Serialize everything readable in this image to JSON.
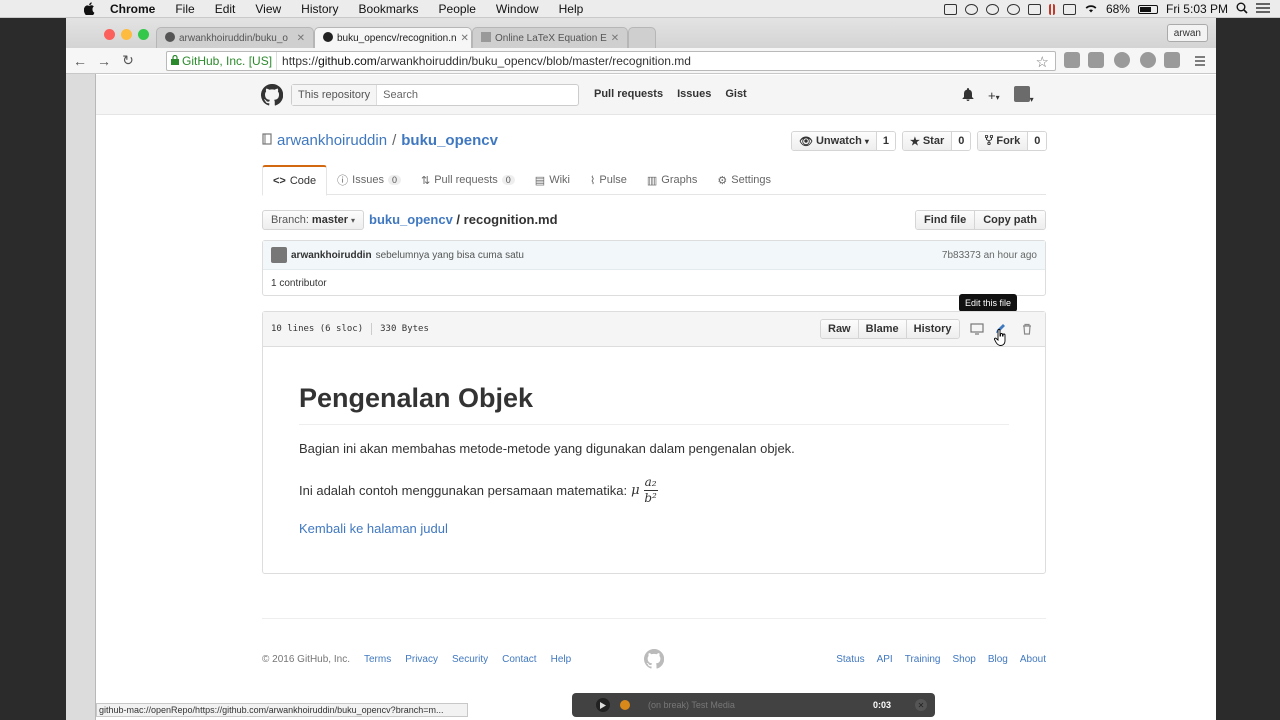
{
  "macos": {
    "app_name": "Chrome",
    "menus": [
      "File",
      "Edit",
      "View",
      "History",
      "Bookmarks",
      "People",
      "Window",
      "Help"
    ],
    "battery": "68%",
    "clock": "Fri 5:03 PM"
  },
  "browser": {
    "tabs": [
      {
        "label": "arwankhoiruddin/buku_o"
      },
      {
        "label": "buku_opencv/recognition.n"
      },
      {
        "label": "Online LaTeX Equation E"
      }
    ],
    "profile": "arwan",
    "ev_cert": "GitHub, Inc. [US]",
    "url_prefix": "https://",
    "url_host": "github.com",
    "url_path": "/arwankhoiruddin/buku_opencv/blob/master/recognition.md",
    "status_url": "github-mac://openRepo/https://github.com/arwankhoiruddin/buku_opencv?branch=m..."
  },
  "gh_header": {
    "search_scope": "This repository",
    "search_placeholder": "Search",
    "nav": [
      "Pull requests",
      "Issues",
      "Gist"
    ],
    "plus": "+"
  },
  "repo": {
    "owner": "arwankhoiruddin",
    "separator": "/",
    "name": "buku_opencv",
    "watch_label": "Unwatch",
    "watch_count": "1",
    "star_label": "Star",
    "star_count": "0",
    "fork_label": "Fork",
    "fork_count": "0"
  },
  "repo_nav": [
    {
      "label": "Code",
      "count": ""
    },
    {
      "label": "Issues",
      "count": "0"
    },
    {
      "label": "Pull requests",
      "count": "0"
    },
    {
      "label": "Wiki",
      "count": ""
    },
    {
      "label": "Pulse",
      "count": ""
    },
    {
      "label": "Graphs",
      "count": ""
    },
    {
      "label": "Settings",
      "count": ""
    }
  ],
  "branch": {
    "prefix": "Branch:",
    "name": "master",
    "crumb_repo": "buku_opencv",
    "crumb_sep": "/",
    "crumb_file": "recognition.md",
    "find_file": "Find file",
    "copy_path": "Copy path"
  },
  "commit": {
    "author": "arwankhoiruddin",
    "message": "sebelumnya yang bisa cuma satu",
    "sha": "7b83373",
    "time": "an hour ago",
    "contributors": "1 contributor"
  },
  "file": {
    "lines": "10 lines (6 sloc)",
    "size": "330 Bytes",
    "raw": "Raw",
    "blame": "Blame",
    "history": "History",
    "tooltip": "Edit this file"
  },
  "markdown": {
    "heading": "Pengenalan Objek",
    "para1": "Bagian ini akan membahas metode-metode yang digunakan dalam pengenalan objek.",
    "para2": "Ini adalah contoh menggunakan persamaan matematika:",
    "math_mu": "μ",
    "math_num": "a₂",
    "math_den": "b²",
    "link": "Kembali ke halaman judul"
  },
  "footer": {
    "copyright": "© 2016 GitHub, Inc.",
    "left_links": [
      "Terms",
      "Privacy",
      "Security",
      "Contact",
      "Help"
    ],
    "right_links": [
      "Status",
      "API",
      "Training",
      "Shop",
      "Blog",
      "About"
    ]
  },
  "media_bar": {
    "title": "(on break) Test Media",
    "time": "0:03"
  }
}
